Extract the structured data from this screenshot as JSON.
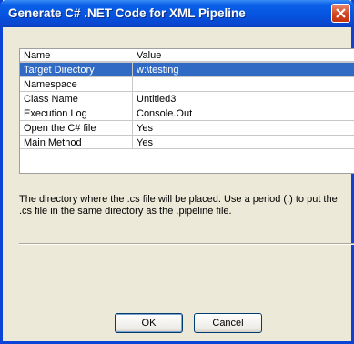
{
  "window": {
    "title": "Generate C# .NET Code for XML Pipeline"
  },
  "grid": {
    "headers": {
      "name": "Name",
      "value": "Value"
    },
    "rows": [
      {
        "name": "Target Directory",
        "value": "w:\\testing",
        "selected": true
      },
      {
        "name": "Namespace",
        "value": ""
      },
      {
        "name": "Class Name",
        "value": "Untitled3"
      },
      {
        "name": "Execution Log",
        "value": "Console.Out"
      },
      {
        "name": "Open the C# file",
        "value": "Yes"
      },
      {
        "name": "Main Method",
        "value": "Yes"
      }
    ]
  },
  "description": {
    "text": "The directory where the .cs file will be placed. Use a period (.) to put the .cs file in the same directory as the .pipeline file."
  },
  "buttons": {
    "ok_label": "OK",
    "cancel_label": "Cancel"
  },
  "icons": {
    "close": "close-icon"
  },
  "colors": {
    "titlebar": "#0554e0",
    "selection": "#316ac5",
    "close": "#d2461f",
    "window_bg": "#ece9d8"
  }
}
